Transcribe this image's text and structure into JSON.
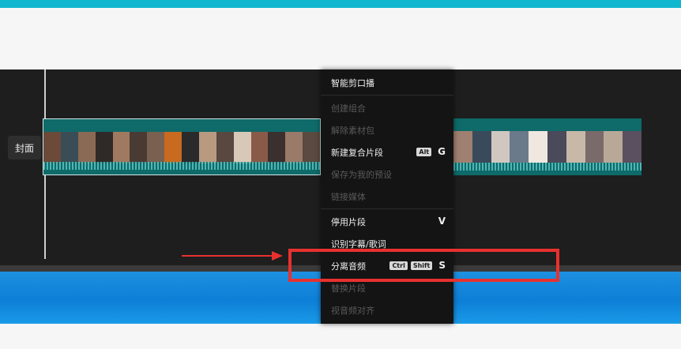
{
  "timeline": {
    "cover_label": "封面"
  },
  "menu": {
    "items": [
      {
        "label": "智能剪口播",
        "disabled": false
      },
      {
        "label": "创建组合",
        "disabled": true
      },
      {
        "label": "解除素材包",
        "disabled": true
      },
      {
        "label": "新建复合片段",
        "disabled": false,
        "shortcut_keys": [
          "Alt"
        ],
        "shortcut_letter": "G"
      },
      {
        "label": "保存为我的预设",
        "disabled": true
      },
      {
        "label": "链接媒体",
        "disabled": true
      },
      {
        "label": "停用片段",
        "disabled": false,
        "shortcut_letter": "V"
      },
      {
        "label": "识别字幕/歌词",
        "disabled": false
      },
      {
        "label": "分离音频",
        "disabled": false,
        "shortcut_keys": [
          "Ctrl",
          "Shift"
        ],
        "shortcut_letter": "S"
      },
      {
        "label": "替换片段",
        "disabled": true
      },
      {
        "label": "视音频对齐",
        "disabled": true
      }
    ]
  },
  "colors": {
    "highlight": "#e8312f",
    "accent": "#11b7cf",
    "clip": "#0f6a6a"
  }
}
